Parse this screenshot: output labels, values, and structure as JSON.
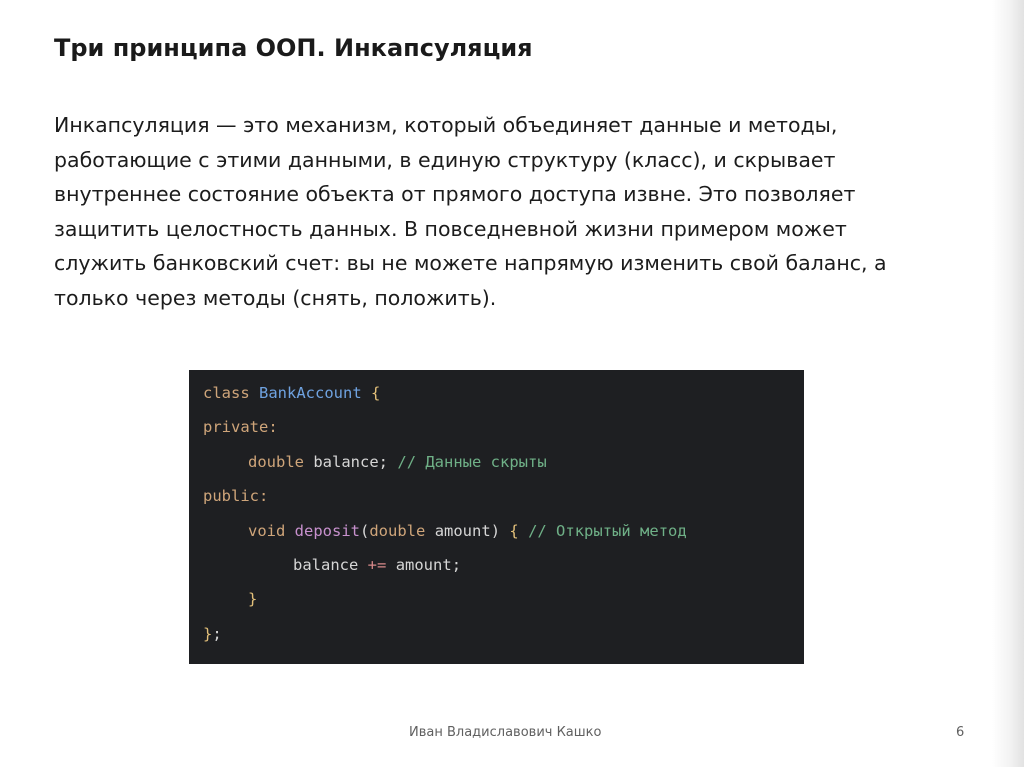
{
  "slide": {
    "title": "Три принципа ООП. Инкапсуляция",
    "paragraph_lines": [
      "Инкапсуляция — это механизм, который объединяет данные и методы,",
      "работающие с этими данными, в единую структуру (класс), и скрывает",
      "внутреннее состояние объекта от прямого доступа извне. Это позволяет",
      "защитить целостность данных. В повседневной жизни примером может",
      "служить банковский счет: вы не можете напрямую изменить свой баланс, а",
      "только через методы (снять, положить)."
    ]
  },
  "code": {
    "line1": {
      "kw": "class",
      "name": "BankAccount",
      "brace": "{"
    },
    "line2": {
      "kw": "private:"
    },
    "line3": {
      "type": "double",
      "var": "balance",
      "semi": ";",
      "comment": "// Данные скрыты"
    },
    "line4": {
      "kw": "public:"
    },
    "line5": {
      "ret": "void",
      "fn": "deposit",
      "open": "(",
      "ptype": "double",
      "param": "amount",
      "close": ")",
      "brace": "{",
      "comment": "// Открытый метод"
    },
    "line6": {
      "var": "balance",
      "op": "+=",
      "arg": "amount",
      "semi": ";"
    },
    "line7": {
      "brace": "}"
    },
    "line8": {
      "brace": "}",
      "semi": ";"
    }
  },
  "footer": {
    "author": "Иван Владиславович Кашко",
    "page_number": "6"
  },
  "colors": {
    "code_background": "#1e1f22",
    "keyword": "#cfa57a",
    "class_name": "#6fa2e0",
    "function_name": "#c891ce",
    "comment": "#6fb087",
    "operator": "#d88a8a"
  }
}
